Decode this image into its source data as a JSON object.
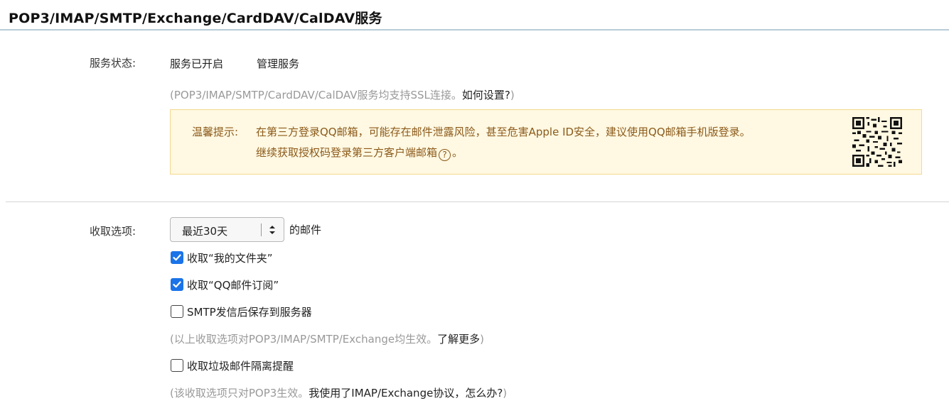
{
  "header": {
    "title": "POP3/IMAP/SMTP/Exchange/CardDAV/CalDAV服务"
  },
  "service": {
    "label": "服务状态:",
    "status": "服务已开启",
    "manage_link": "管理服务",
    "note_prefix": "(POP3/IMAP/SMTP/CardDAV/CalDAV服务均支持SSL连接。",
    "note_link": "如何设置?",
    "note_suffix": ")"
  },
  "notice": {
    "label": "温馨提示:",
    "line1": "在第三方登录QQ邮箱，可能存在邮件泄露风险，甚至危害Apple ID安全，建议使用QQ邮箱手机版登录。",
    "line2": "继续获取授权码登录第三方客户端邮箱",
    "help_icon_text": "?",
    "line2_suffix": "。",
    "qr_icon": "qr-code-icon"
  },
  "fetch": {
    "label": "收取选项:",
    "range_select": {
      "value": "最近30天",
      "suffix": "的邮件"
    },
    "options": [
      {
        "label": "收取“我的文件夹”",
        "checked": true
      },
      {
        "label": "收取“QQ邮件订阅”",
        "checked": true
      },
      {
        "label": "SMTP发信后保存到服务器",
        "checked": false
      }
    ],
    "note1_prefix": "(以上收取选项对POP3/IMAP/SMTP/Exchange均生效。",
    "note1_link": "了解更多",
    "note1_suffix": ")",
    "spam_option": {
      "label": "收取垃圾邮件隔离提醒",
      "checked": false
    },
    "note2_prefix": "(该收取选项只对POP3生效。",
    "note2_link": "我使用了IMAP/Exchange协议，怎么办?",
    "note2_suffix": ")"
  },
  "colors": {
    "accent": "#1a73e8",
    "notice_bg": "#fff8e2",
    "notice_text": "#8b5a1a",
    "muted": "#999999"
  }
}
